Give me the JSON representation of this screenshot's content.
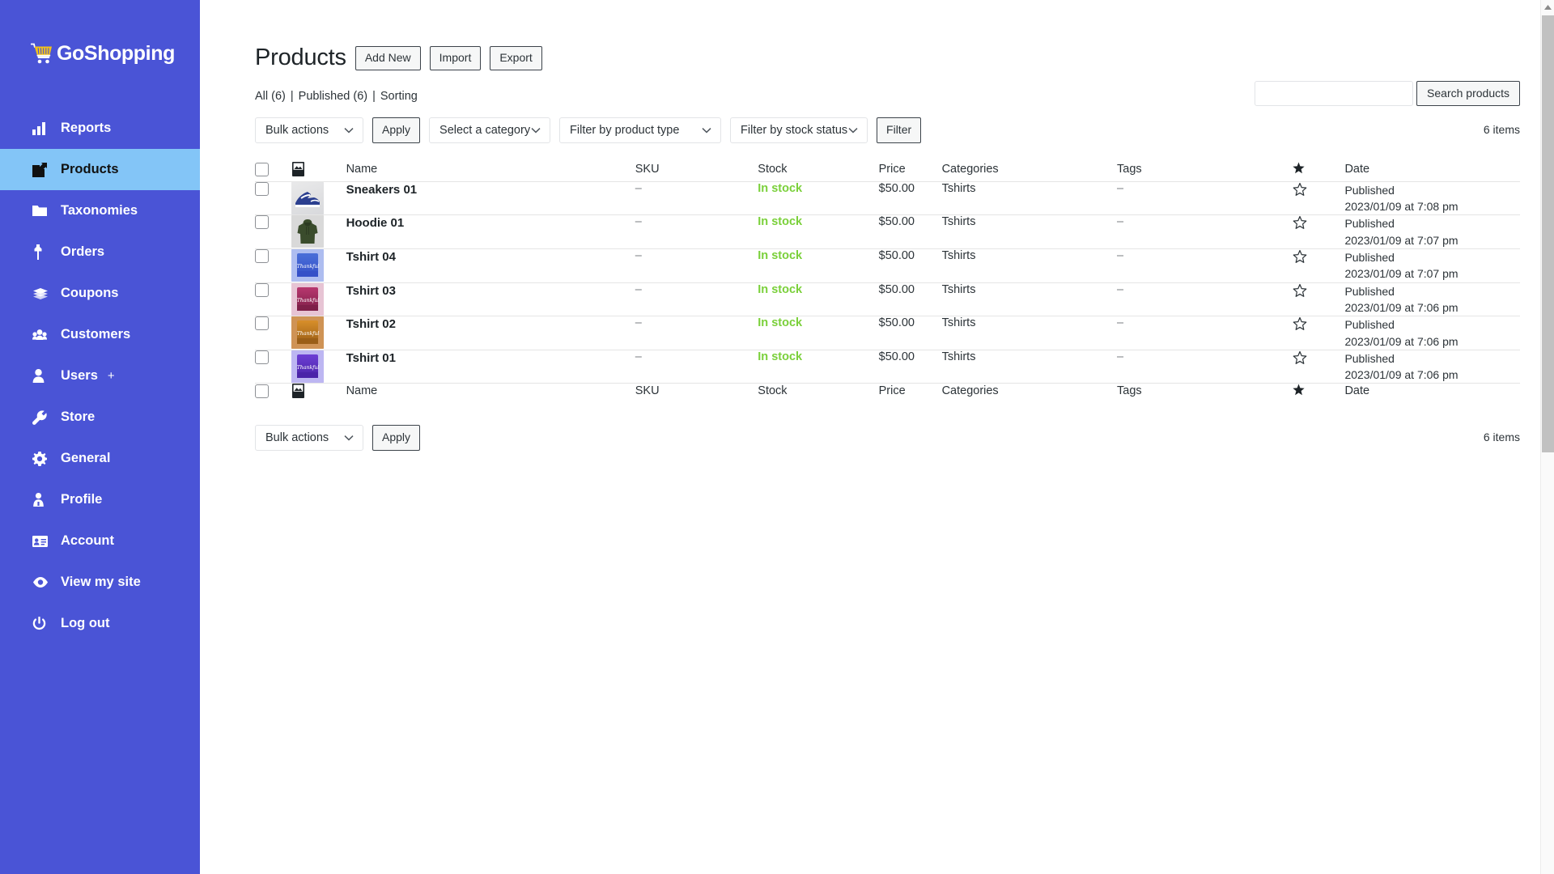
{
  "brand": {
    "name": "GoShopping",
    "logo_icon": "shopping-cart-icon",
    "sidebar_bg": "#4a54d6",
    "active_bg": "#83c5f7"
  },
  "sidebar": {
    "items": [
      {
        "label": "Reports",
        "icon": "bar-chart-icon",
        "active": false
      },
      {
        "label": "Products",
        "icon": "edit-square-icon",
        "active": true
      },
      {
        "label": "Taxonomies",
        "icon": "folder-icon",
        "active": false
      },
      {
        "label": "Orders",
        "icon": "pin-icon",
        "active": false
      },
      {
        "label": "Coupons",
        "icon": "tickets-icon",
        "active": false
      },
      {
        "label": "Customers",
        "icon": "group-icon",
        "active": false
      },
      {
        "label": "Users",
        "icon": "user-icon",
        "active": false,
        "suffix": "+"
      },
      {
        "label": "Store",
        "icon": "wrench-icon",
        "active": false
      },
      {
        "label": "General",
        "icon": "gear-icon",
        "active": false
      },
      {
        "label": "Profile",
        "icon": "person-info-icon",
        "active": false
      },
      {
        "label": "Account",
        "icon": "id-card-icon",
        "active": false
      },
      {
        "label": "View my site",
        "icon": "eye-icon",
        "active": false
      },
      {
        "label": "Log out",
        "icon": "power-icon",
        "active": false
      }
    ]
  },
  "header": {
    "title": "Products",
    "add_new": "Add New",
    "import": "Import",
    "export": "Export"
  },
  "views": {
    "all": "All (6)",
    "published": "Published (6)",
    "sorting": "Sorting",
    "separator": "|"
  },
  "search": {
    "value": "",
    "placeholder": "",
    "button": "Search products"
  },
  "tablenav_top": {
    "bulk_actions": "Bulk actions",
    "apply": "Apply",
    "category": "Select a category",
    "product_type": "Filter by product type",
    "stock_status": "Filter by stock status",
    "filter": "Filter",
    "items_count": "6 items"
  },
  "tablenav_bottom": {
    "bulk_actions": "Bulk actions",
    "apply": "Apply",
    "items_count": "6 items"
  },
  "table": {
    "columns": {
      "checkbox": "",
      "image": "image-column-icon",
      "name": "Name",
      "sku": "SKU",
      "stock": "Stock",
      "price": "Price",
      "categories": "Categories",
      "tags": "Tags",
      "featured": "star-icon",
      "date": "Date"
    },
    "rows": [
      {
        "name": "Sneakers 01",
        "sku": "–",
        "stock": "In stock",
        "price": "$50.00",
        "categories": "Tshirts",
        "tags": "–",
        "featured": false,
        "date_status": "Published",
        "date_value": "2023/01/09 at 7:08 pm",
        "thumb_kind": "sneaker",
        "thumb_bg": "#e4e5e7",
        "thumb_color": "#2b3f8f"
      },
      {
        "name": "Hoodie 01",
        "sku": "–",
        "stock": "In stock",
        "price": "$50.00",
        "categories": "Tshirts",
        "tags": "–",
        "featured": false,
        "date_status": "Published",
        "date_value": "2023/01/09 at 7:07 pm",
        "thumb_kind": "hoodie",
        "thumb_bg": "#d9d9d9",
        "thumb_color": "#3a4c2c"
      },
      {
        "name": "Tshirt 04",
        "sku": "–",
        "stock": "In stock",
        "price": "$50.00",
        "categories": "Tshirts",
        "tags": "–",
        "featured": false,
        "date_status": "Published",
        "date_value": "2023/01/09 at 7:07 pm",
        "thumb_kind": "tshirt",
        "thumb_bg": "#aebdf0",
        "thumb_color": "#4a6fd8",
        "thumb_band": "#3550c8",
        "thumb_text": "Thankful"
      },
      {
        "name": "Tshirt 03",
        "sku": "–",
        "stock": "In stock",
        "price": "$50.00",
        "categories": "Tshirts",
        "tags": "–",
        "featured": false,
        "date_status": "Published",
        "date_value": "2023/01/09 at 7:06 pm",
        "thumb_kind": "tshirt",
        "thumb_bg": "#e7c4d4",
        "thumb_color": "#b8376f",
        "thumb_band": "#7e1f48",
        "thumb_text": "Thankful"
      },
      {
        "name": "Tshirt 02",
        "sku": "–",
        "stock": "In stock",
        "price": "$50.00",
        "categories": "Tshirts",
        "tags": "–",
        "featured": false,
        "date_status": "Published",
        "date_value": "2023/01/09 at 7:06 pm",
        "thumb_kind": "tshirt",
        "thumb_bg": "#cf9355",
        "thumb_color": "#d88f2a",
        "thumb_band": "#9a5e17",
        "thumb_text": "Thankful"
      },
      {
        "name": "Tshirt 01",
        "sku": "–",
        "stock": "In stock",
        "price": "$50.00",
        "categories": "Tshirts",
        "tags": "–",
        "featured": false,
        "date_status": "Published",
        "date_value": "2023/01/09 at 7:06 pm",
        "thumb_kind": "tshirt",
        "thumb_bg": "#bdb6f2",
        "thumb_color": "#6d3fd4",
        "thumb_band": "#4a23a8",
        "thumb_text": "Thankful"
      }
    ]
  },
  "colors": {
    "in_stock": "#7ad03a",
    "link": "#2271b1",
    "text": "#2c3338"
  }
}
